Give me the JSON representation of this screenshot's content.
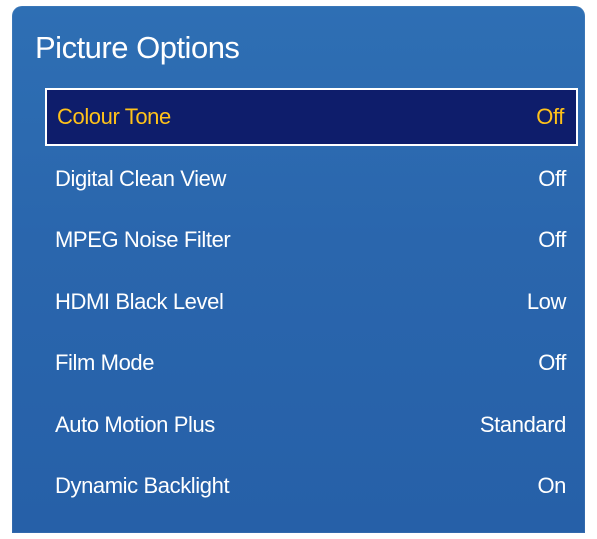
{
  "menu": {
    "title": "Picture Options",
    "selected_index": 0,
    "items": [
      {
        "label": "Colour Tone",
        "value": "Off"
      },
      {
        "label": "Digital Clean View",
        "value": "Off"
      },
      {
        "label": "MPEG Noise Filter",
        "value": "Off"
      },
      {
        "label": "HDMI Black Level",
        "value": "Low"
      },
      {
        "label": "Film Mode",
        "value": "Off"
      },
      {
        "label": "Auto Motion Plus",
        "value": "Standard"
      },
      {
        "label": "Dynamic Backlight",
        "value": "On"
      }
    ]
  },
  "colors": {
    "panel": "#2a66ad",
    "selected_background": "#0e1d6b",
    "selected_text": "#ffc21a",
    "text": "#ffffff"
  }
}
